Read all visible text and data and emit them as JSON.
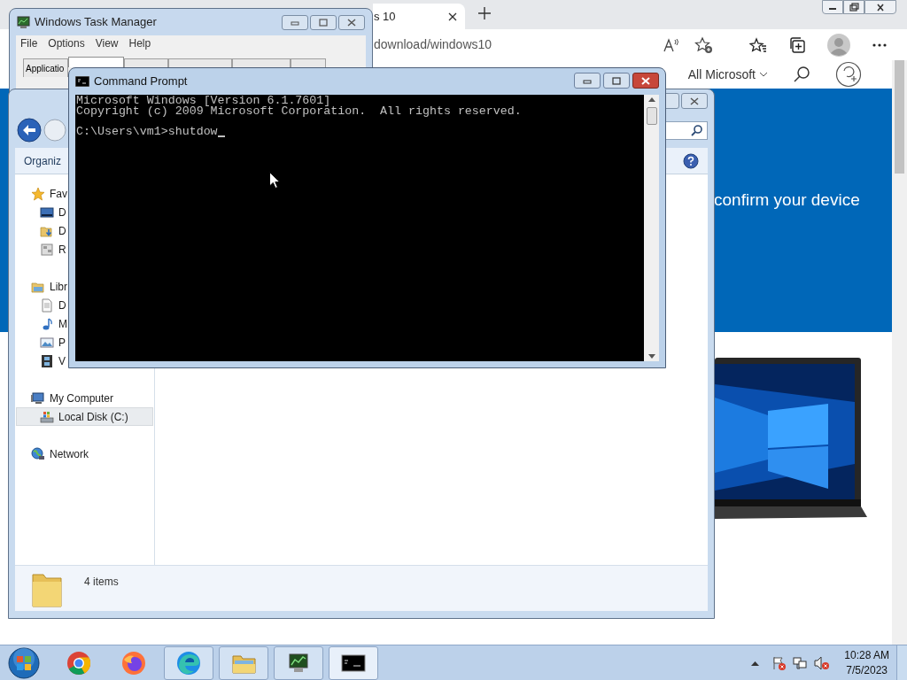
{
  "browser": {
    "tab_title": "s 10",
    "address": "download/windows10",
    "nav_link": "All Microsoft",
    "banner_text": "confirm your device"
  },
  "task_manager": {
    "title": "Windows Task Manager",
    "menu": [
      "File",
      "Options",
      "View",
      "Help"
    ],
    "tabs": [
      {
        "label": "Applicatio",
        "selected": false
      },
      {
        "selected": true
      },
      {
        "selected": false
      },
      {
        "selected": false
      },
      {
        "selected": false
      },
      {
        "selected": false
      }
    ]
  },
  "explorer": {
    "toolbar_button": "Organiz",
    "nav": [
      {
        "label": "Fav",
        "kind": "star",
        "selected": false,
        "children": [
          {
            "label": "D",
            "kind": "desktop",
            "selected": false
          },
          {
            "label": "D",
            "kind": "downloads",
            "selected": false
          },
          {
            "label": "R",
            "kind": "recent",
            "selected": false
          }
        ]
      },
      {
        "label": "Libr",
        "kind": "library",
        "selected": false,
        "children": [
          {
            "label": "D",
            "kind": "documents",
            "selected": false
          },
          {
            "label": "M",
            "kind": "music",
            "selected": false
          },
          {
            "label": "P",
            "kind": "pictures",
            "selected": false
          },
          {
            "label": "V",
            "kind": "videos",
            "selected": false
          }
        ]
      },
      {
        "label": "My Computer",
        "kind": "computer",
        "selected": false,
        "children": [
          {
            "label": "Local Disk (C:)",
            "kind": "disk",
            "selected": true
          }
        ]
      },
      {
        "label": "Network",
        "kind": "network",
        "selected": false
      }
    ],
    "status": "4 items"
  },
  "cmd": {
    "title": "Command Prompt",
    "lines": [
      "Microsoft Windows [Version 6.1.7601]",
      "Copyright (c) 2009 Microsoft Corporation.  All rights reserved."
    ],
    "prompt": "C:\\Users\\vm1>shutdow"
  },
  "taskbar": {
    "items": [
      {
        "kind": "chrome",
        "running": false,
        "selected": false
      },
      {
        "kind": "firefox",
        "running": false,
        "selected": false
      },
      {
        "kind": "edge",
        "running": true,
        "selected": false
      },
      {
        "kind": "explorer",
        "running": true,
        "selected": false
      },
      {
        "kind": "taskmgr",
        "running": true,
        "selected": false
      },
      {
        "kind": "cmd",
        "running": true,
        "selected": true
      }
    ],
    "clock": {
      "time": "10:28 AM",
      "date": "7/5/2023"
    }
  }
}
